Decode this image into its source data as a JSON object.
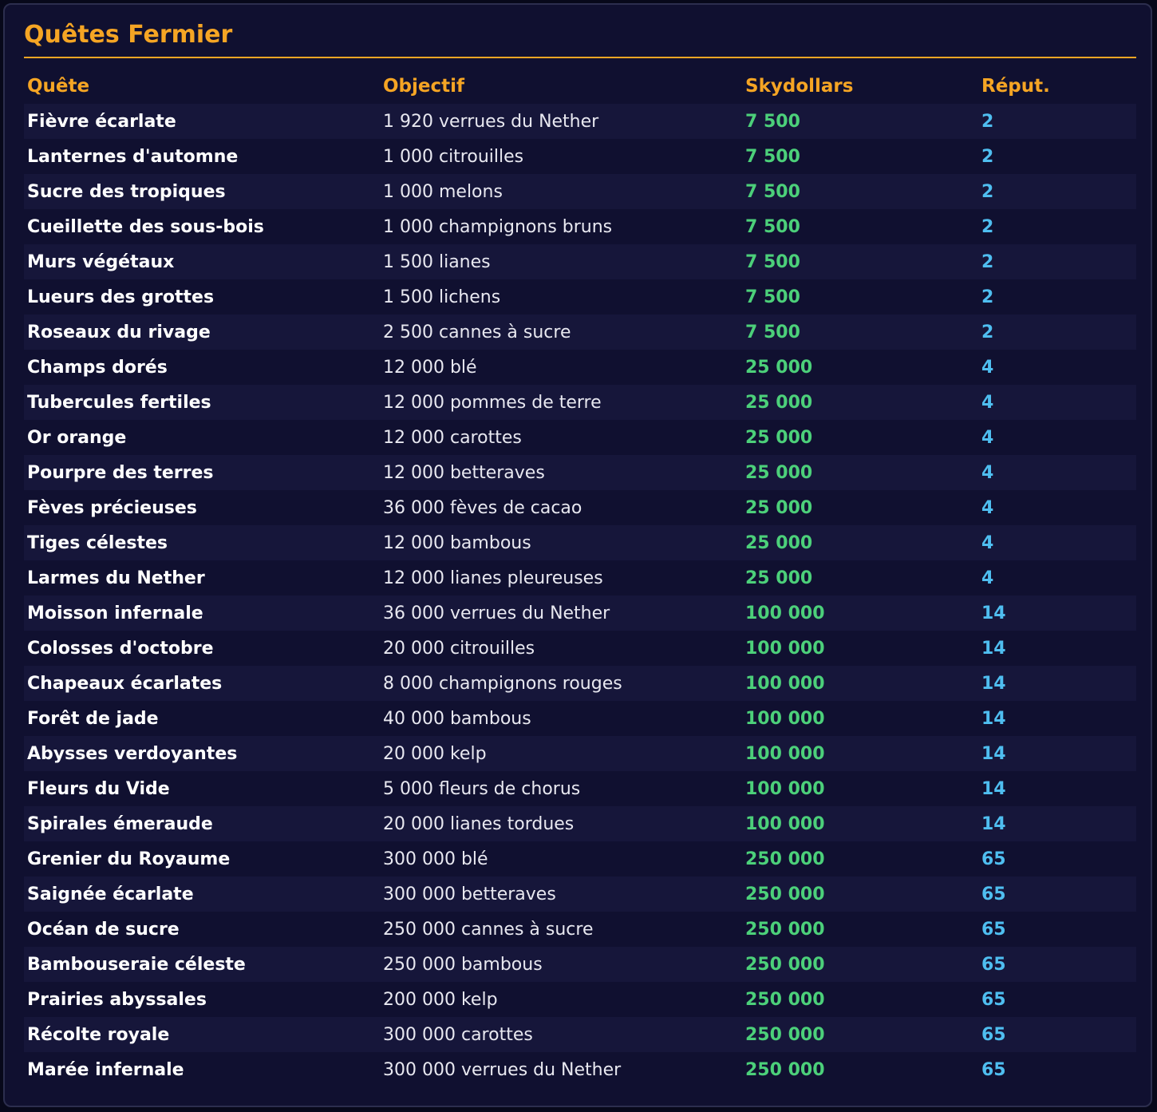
{
  "title": "Quêtes Fermier",
  "colors": {
    "accent": "#f5a524",
    "money": "#4cd07a",
    "reputation": "#4fbef0",
    "background": "#101030"
  },
  "columns": [
    "Quête",
    "Objectif",
    "Skydollars",
    "Réput."
  ],
  "rows": [
    {
      "quest": "Fièvre écarlate",
      "objective": "1 920 verrues du Nether",
      "skydollars": "7 500",
      "reputation": "2"
    },
    {
      "quest": "Lanternes d'automne",
      "objective": "1 000 citrouilles",
      "skydollars": "7 500",
      "reputation": "2"
    },
    {
      "quest": "Sucre des tropiques",
      "objective": "1 000 melons",
      "skydollars": "7 500",
      "reputation": "2"
    },
    {
      "quest": "Cueillette des sous-bois",
      "objective": "1 000 champignons bruns",
      "skydollars": "7 500",
      "reputation": "2"
    },
    {
      "quest": "Murs végétaux",
      "objective": "1 500 lianes",
      "skydollars": "7 500",
      "reputation": "2"
    },
    {
      "quest": "Lueurs des grottes",
      "objective": "1 500 lichens",
      "skydollars": "7 500",
      "reputation": "2"
    },
    {
      "quest": "Roseaux du rivage",
      "objective": "2 500 cannes à sucre",
      "skydollars": "7 500",
      "reputation": "2"
    },
    {
      "quest": "Champs dorés",
      "objective": "12 000 blé",
      "skydollars": "25 000",
      "reputation": "4"
    },
    {
      "quest": "Tubercules fertiles",
      "objective": "12 000 pommes de terre",
      "skydollars": "25 000",
      "reputation": "4"
    },
    {
      "quest": "Or orange",
      "objective": "12 000 carottes",
      "skydollars": "25 000",
      "reputation": "4"
    },
    {
      "quest": "Pourpre des terres",
      "objective": "12 000 betteraves",
      "skydollars": "25 000",
      "reputation": "4"
    },
    {
      "quest": "Fèves précieuses",
      "objective": "36 000 fèves de cacao",
      "skydollars": "25 000",
      "reputation": "4"
    },
    {
      "quest": "Tiges célestes",
      "objective": "12 000 bambous",
      "skydollars": "25 000",
      "reputation": "4"
    },
    {
      "quest": "Larmes du Nether",
      "objective": "12 000 lianes pleureuses",
      "skydollars": "25 000",
      "reputation": "4"
    },
    {
      "quest": "Moisson infernale",
      "objective": "36 000 verrues du Nether",
      "skydollars": "100 000",
      "reputation": "14"
    },
    {
      "quest": "Colosses d'octobre",
      "objective": "20 000 citrouilles",
      "skydollars": "100 000",
      "reputation": "14"
    },
    {
      "quest": "Chapeaux écarlates",
      "objective": "8 000 champignons rouges",
      "skydollars": "100 000",
      "reputation": "14"
    },
    {
      "quest": "Forêt de jade",
      "objective": "40 000 bambous",
      "skydollars": "100 000",
      "reputation": "14"
    },
    {
      "quest": "Abysses verdoyantes",
      "objective": "20 000 kelp",
      "skydollars": "100 000",
      "reputation": "14"
    },
    {
      "quest": "Fleurs du Vide",
      "objective": "5 000 fleurs de chorus",
      "skydollars": "100 000",
      "reputation": "14"
    },
    {
      "quest": "Spirales émeraude",
      "objective": "20 000 lianes tordues",
      "skydollars": "100 000",
      "reputation": "14"
    },
    {
      "quest": "Grenier du Royaume",
      "objective": "300 000 blé",
      "skydollars": "250 000",
      "reputation": "65"
    },
    {
      "quest": "Saignée écarlate",
      "objective": "300 000 betteraves",
      "skydollars": "250 000",
      "reputation": "65"
    },
    {
      "quest": "Océan de sucre",
      "objective": "250 000 cannes à sucre",
      "skydollars": "250 000",
      "reputation": "65"
    },
    {
      "quest": "Bambouseraie céleste",
      "objective": "250 000 bambous",
      "skydollars": "250 000",
      "reputation": "65"
    },
    {
      "quest": "Prairies abyssales",
      "objective": "200 000 kelp",
      "skydollars": "250 000",
      "reputation": "65"
    },
    {
      "quest": "Récolte royale",
      "objective": "300 000 carottes",
      "skydollars": "250 000",
      "reputation": "65"
    },
    {
      "quest": "Marée infernale",
      "objective": "300 000 verrues du Nether",
      "skydollars": "250 000",
      "reputation": "65"
    }
  ]
}
